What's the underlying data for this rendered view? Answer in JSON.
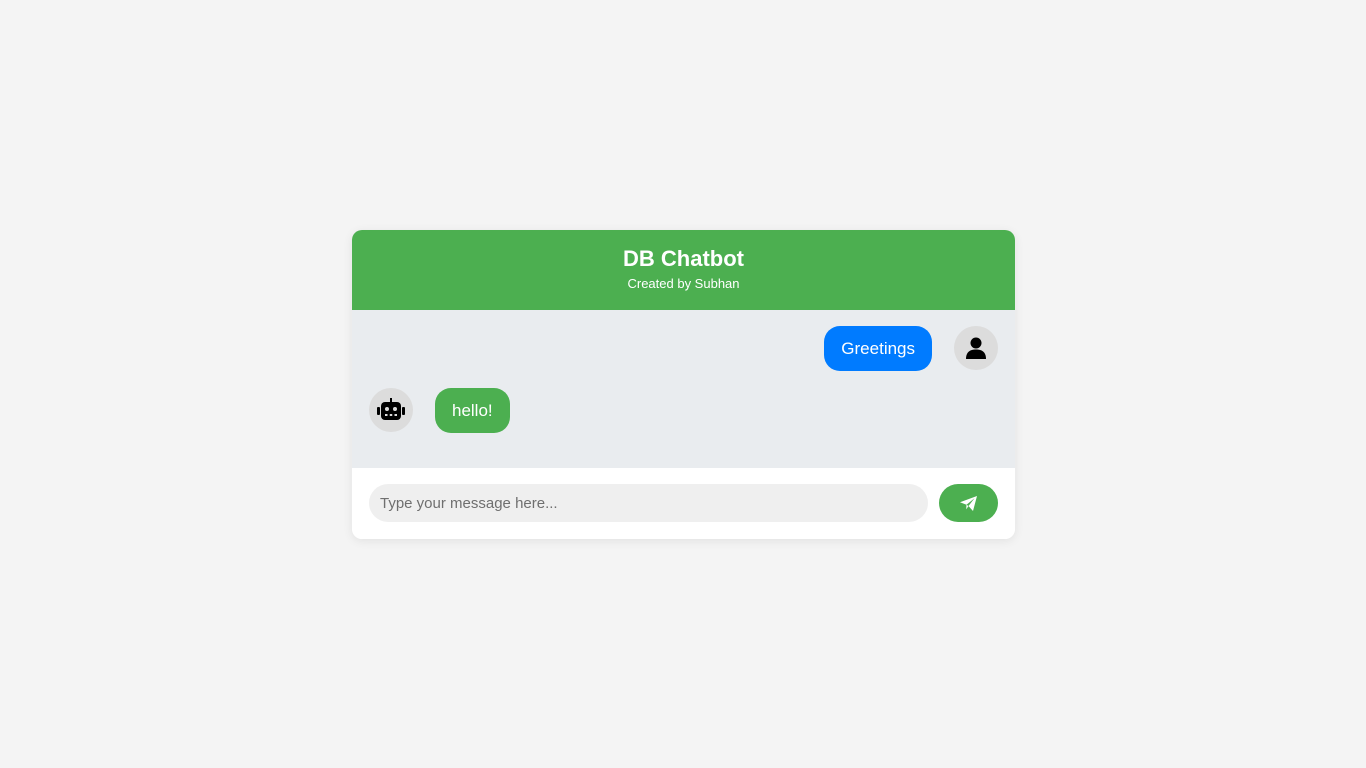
{
  "header": {
    "title": "DB Chatbot",
    "subtitle": "Created by Subhan"
  },
  "messages": [
    {
      "sender": "user",
      "text": "Greetings",
      "avatar_icon": "user-icon",
      "bubble_color": "#007bff"
    },
    {
      "sender": "bot",
      "text": "hello!",
      "avatar_icon": "robot-icon",
      "bubble_color": "#4caf50"
    }
  ],
  "input": {
    "value": "",
    "placeholder": "Type your message here..."
  },
  "send_button": {
    "icon": "paper-plane-icon"
  },
  "colors": {
    "accent": "#4caf50",
    "user_bubble": "#007bff",
    "messages_bg": "#e9ecef",
    "page_bg": "#f4f4f4"
  }
}
